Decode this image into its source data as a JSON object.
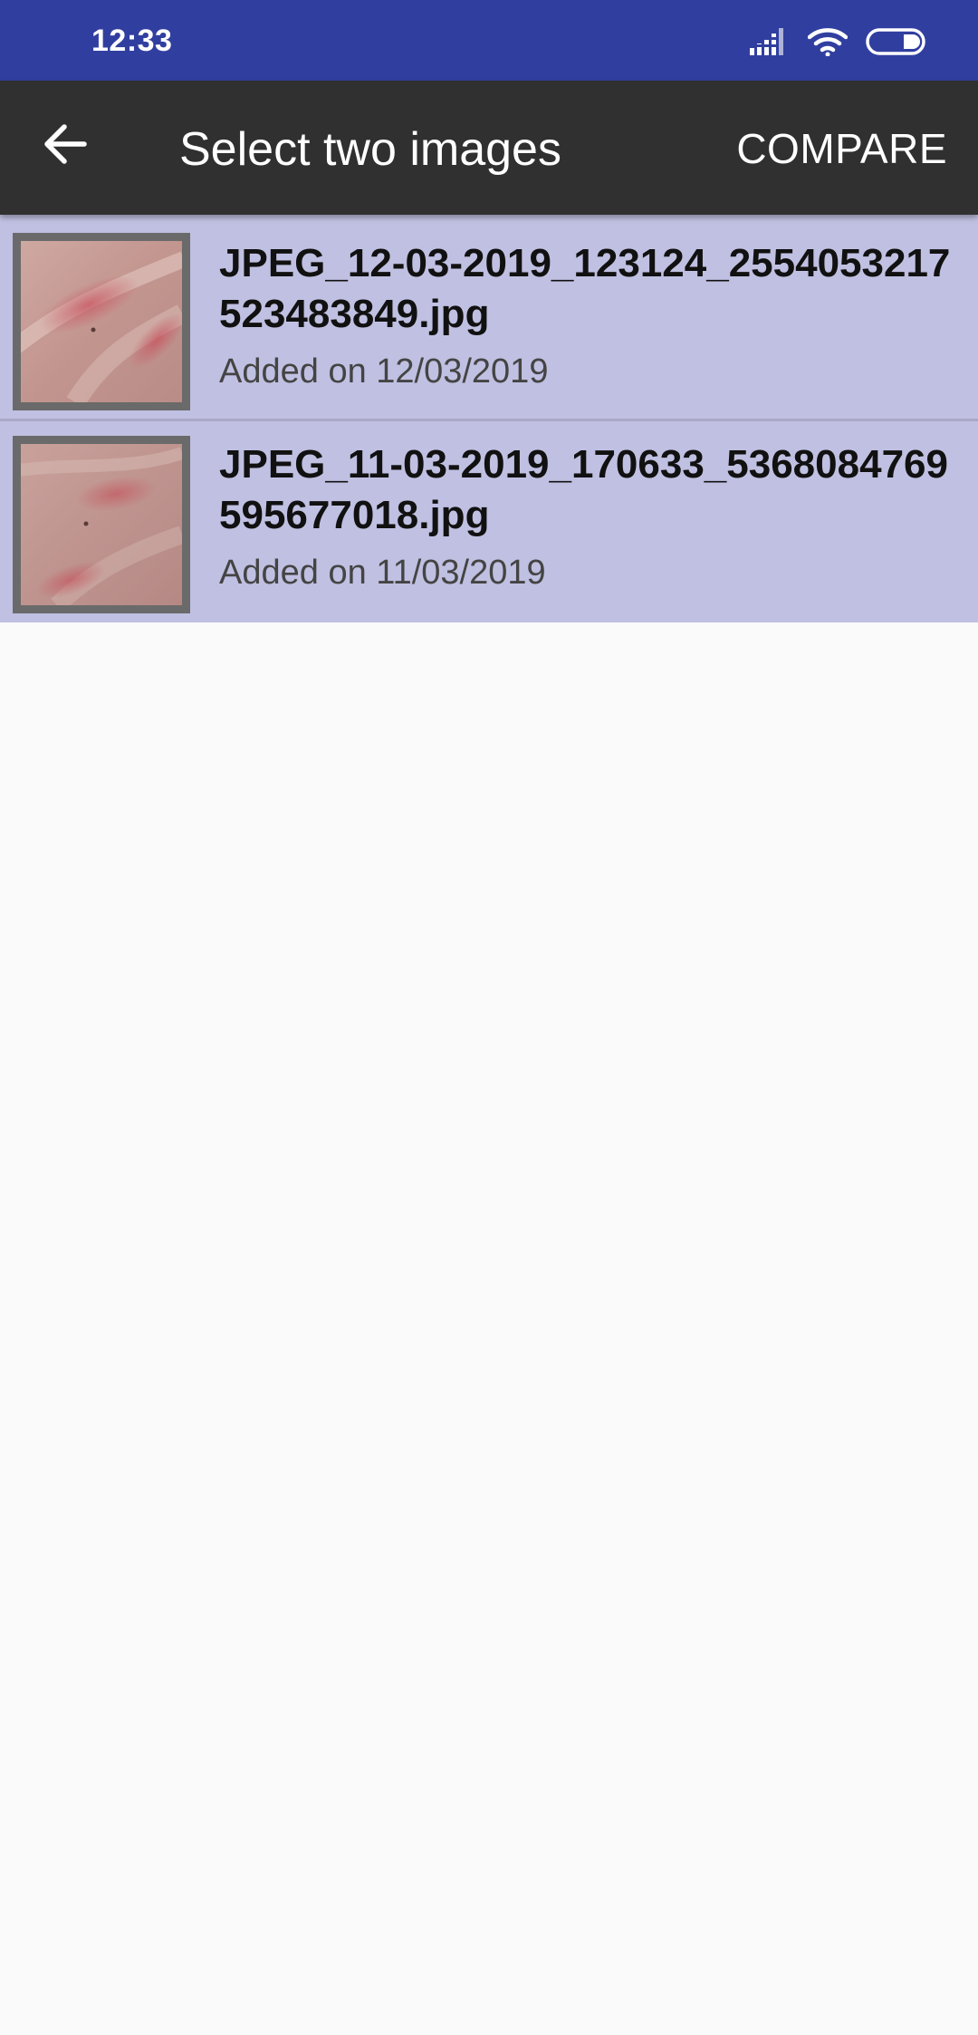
{
  "status_bar": {
    "time": "12:33",
    "icons": [
      "signal-icon",
      "wifi-icon",
      "battery-icon"
    ]
  },
  "app_bar": {
    "back_icon": "arrow-left-icon",
    "title": "Select two images",
    "action_label": "COMPARE"
  },
  "images": [
    {
      "filename": "JPEG_12-03-2019_123124_2554053217523483849.jpg",
      "added": "Added on 12/03/2019",
      "selected": true
    },
    {
      "filename": "JPEG_11-03-2019_170633_5368084769595677018.jpg",
      "added": "Added on 11/03/2019",
      "selected": true
    }
  ],
  "colors": {
    "status_bar": "#303f9f",
    "app_bar": "#303030",
    "selected_row": "#c0c0e2",
    "background": "#fafafa"
  }
}
